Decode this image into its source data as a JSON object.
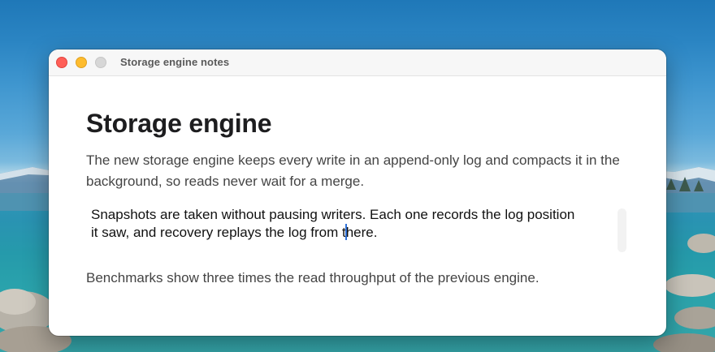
{
  "window": {
    "title": "Storage engine notes"
  },
  "document": {
    "heading": "Storage engine",
    "paragraphs": [
      "The new storage engine keeps every write in an append-only log and compacts it in the background, so reads never wait for a merge.",
      "Benchmarks show three times the read throughput of the previous engine."
    ],
    "editor": {
      "line1": "Snapshots are taken without pausing writers. Each one records the log position",
      "line2_before_caret": "it saw, and recovery replays the log from t",
      "line2_after_caret": "here."
    }
  },
  "colors": {
    "close": "#ff5f57",
    "minimize": "#febc2e",
    "zoom_inactive": "#d7d7d7",
    "caret": "#2f72d9"
  },
  "icons": [
    "close-icon",
    "minimize-icon",
    "zoom-icon"
  ]
}
